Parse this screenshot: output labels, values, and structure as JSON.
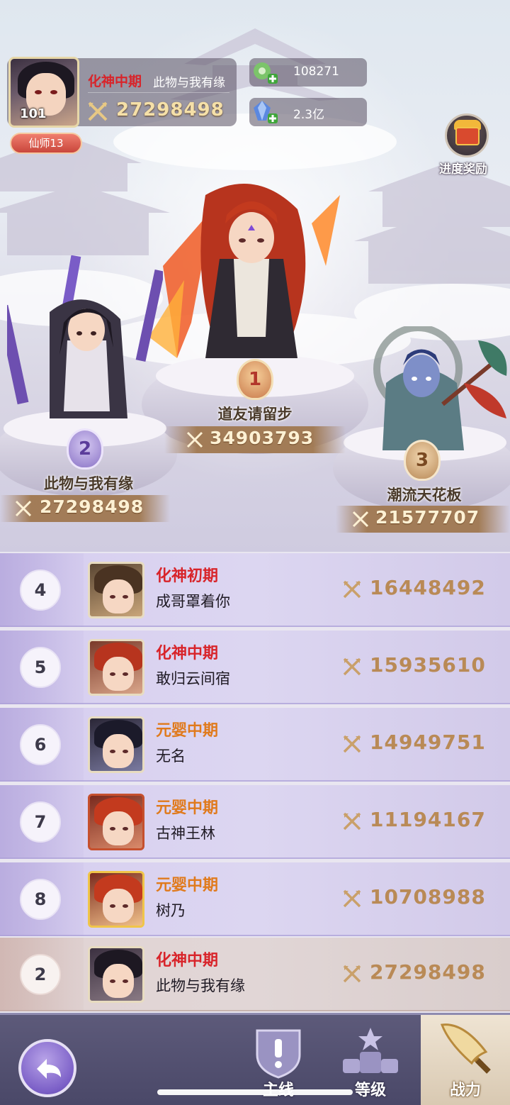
{
  "player": {
    "level": "101",
    "realm": "化神中期",
    "name": "此物与我有缘",
    "power": "27298498",
    "title_badge": "仙师13"
  },
  "resources": [
    {
      "icon": "jade-plus-icon",
      "value": "108271"
    },
    {
      "icon": "crystal-plus-icon",
      "value": "2.3亿"
    }
  ],
  "progress_reward": {
    "label": "进度奖励",
    "icon": "treasure-chest-icon"
  },
  "podium": [
    {
      "rank": "1",
      "name": "道友请留步",
      "power": "34903793"
    },
    {
      "rank": "2",
      "name": "此物与我有缘",
      "power": "27298498"
    },
    {
      "rank": "3",
      "name": "潮流天花板",
      "power": "21577707"
    }
  ],
  "ranking_list": [
    {
      "rank": "4",
      "realm": "化神初期",
      "realm_color": "#d8242a",
      "name": "成哥罩着你",
      "power": "16448492"
    },
    {
      "rank": "5",
      "realm": "化神中期",
      "realm_color": "#d8242a",
      "name": "敢归云间宿",
      "power": "15935610"
    },
    {
      "rank": "6",
      "realm": "元婴中期",
      "realm_color": "#e07a1c",
      "name": "无名",
      "power": "14949751"
    },
    {
      "rank": "7",
      "realm": "元婴中期",
      "realm_color": "#e07a1c",
      "name": "古神王林",
      "power": "11194167"
    },
    {
      "rank": "8",
      "realm": "元婴中期",
      "realm_color": "#e07a1c",
      "name": "树乃",
      "power": "10708988"
    }
  ],
  "self_row": {
    "rank": "2",
    "realm": "化神中期",
    "name": "此物与我有缘",
    "power": "27298498"
  },
  "nav": {
    "main_line": "主线",
    "level": "等级",
    "power": "战力"
  },
  "colors": {
    "realm_red": "#d8242a",
    "realm_orange": "#e07a1c",
    "power_gold": "#b98a56",
    "list_row_bg": "#d8d0f0",
    "self_row_bg": "#e1d4d4"
  }
}
